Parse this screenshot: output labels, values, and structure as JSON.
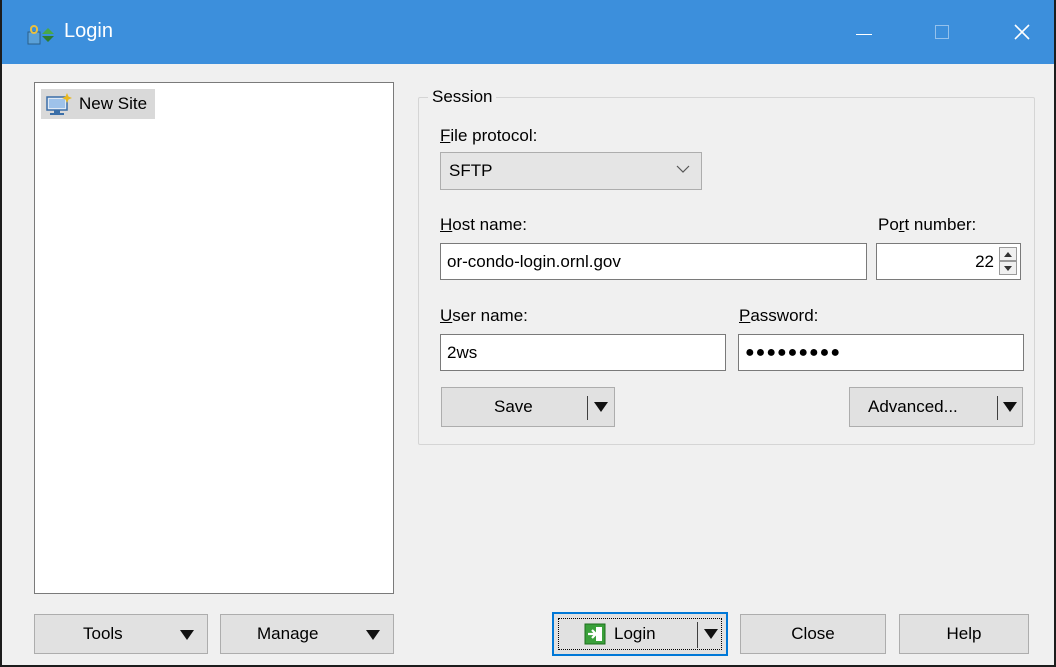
{
  "window": {
    "title": "Login"
  },
  "titlebar_buttons": {
    "minimize": "minimize-icon",
    "maximize": "maximize-icon",
    "close": "close-icon"
  },
  "tree": {
    "items": [
      {
        "label": "New Site",
        "icon": "new-site-icon",
        "selected": true
      }
    ]
  },
  "session": {
    "legend": "Session",
    "protocol_label_key": "F",
    "protocol_label_rest": "ile protocol:",
    "protocol_value": "SFTP",
    "host_label_key": "H",
    "host_label_rest": "ost name:",
    "host_value": "or-condo-login.ornl.gov",
    "port_label_pre": "Po",
    "port_label_key": "r",
    "port_label_rest": "t number:",
    "port_value": "22",
    "user_label_key": "U",
    "user_label_rest": "ser name:",
    "user_value": "2ws",
    "password_label_key": "P",
    "password_label_rest": "assword:",
    "password_mask": "●●●●●●●●●"
  },
  "buttons": {
    "save": "Save",
    "advanced": "Advanced...",
    "tools": "Tools",
    "manage": "Manage",
    "login": "Login",
    "close": "Close",
    "help": "Help"
  },
  "colors": {
    "titlebar": "#3c8fdc",
    "window_bg": "#f0f0f0",
    "focus": "#0078d7"
  }
}
